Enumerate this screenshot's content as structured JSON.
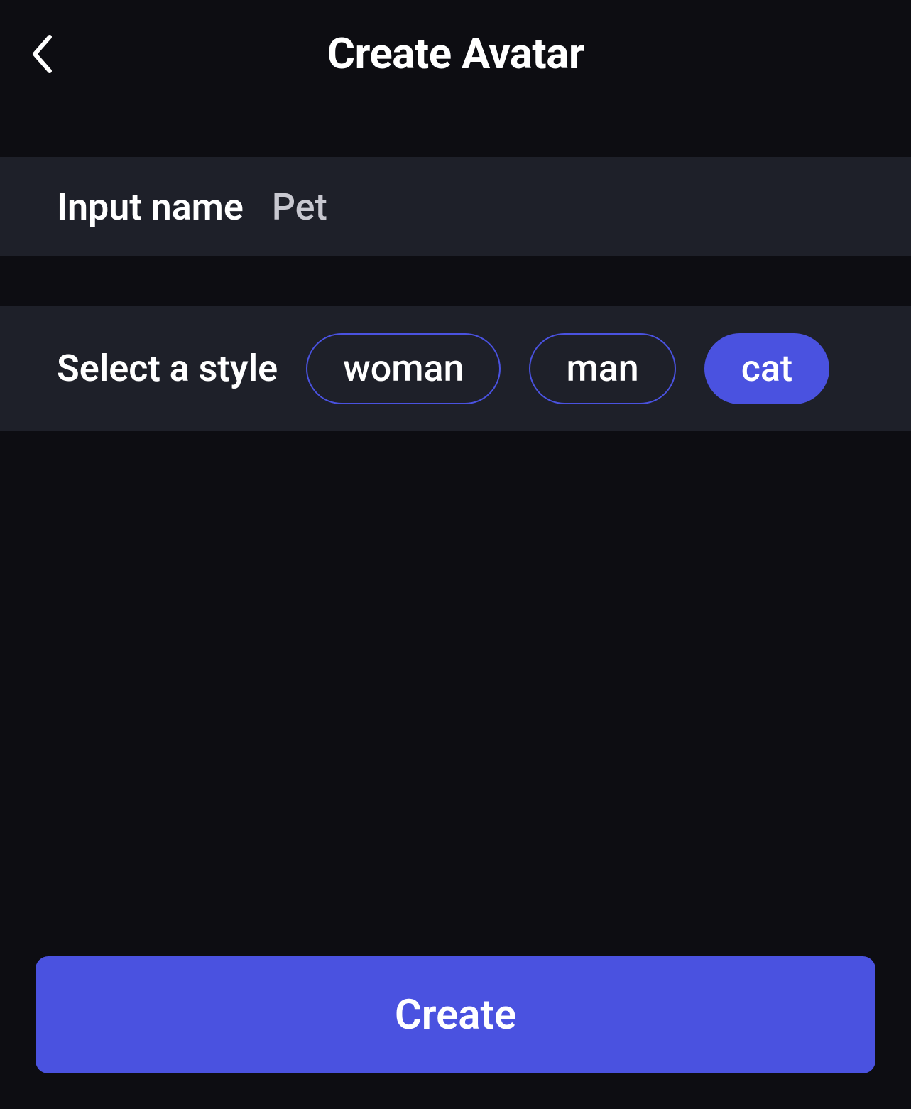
{
  "header": {
    "title": "Create Avatar"
  },
  "input": {
    "label": "Input name",
    "value": "Pet"
  },
  "style": {
    "label": "Select a style",
    "options": [
      {
        "label": "woman",
        "selected": false
      },
      {
        "label": "man",
        "selected": false
      },
      {
        "label": "cat",
        "selected": true
      }
    ]
  },
  "actions": {
    "create_label": "Create"
  }
}
